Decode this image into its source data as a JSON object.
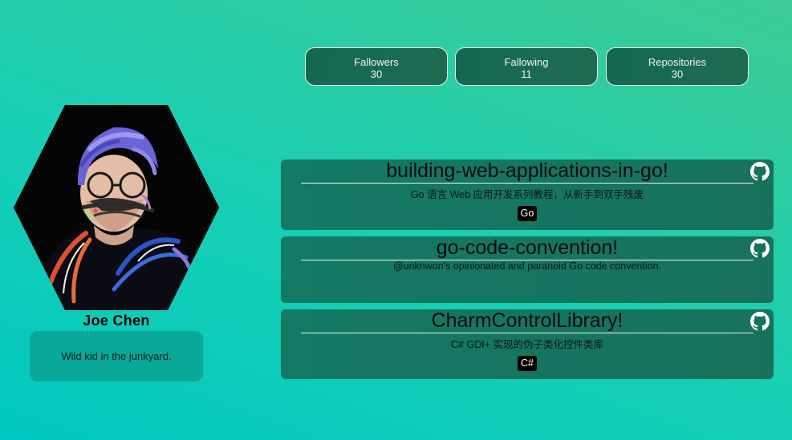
{
  "stats": {
    "followers": {
      "label": "Fallowers",
      "value": "30"
    },
    "following": {
      "label": "Fallowing",
      "value": "11"
    },
    "repositories": {
      "label": "Repositories",
      "value": "30"
    }
  },
  "profile": {
    "name": "Joe Chen",
    "bio": "Wild kid in the junkyard.",
    "avatar_icon": "portrait-avatar"
  },
  "repos": [
    {
      "title": "building-web-applications-in-go!",
      "description": "Go 语言 Web 应用开发系列教程，从新手到双手残废",
      "language": "Go",
      "icon": "github-icon"
    },
    {
      "title": "go-code-convention!",
      "description": "@unknwon's opinionated and paranoid Go code convention.",
      "language": "",
      "icon": "github-icon"
    },
    {
      "title": "CharmControlLibrary!",
      "description": "C# GDI+ 实现的伪子类化控件类库",
      "language": "C#",
      "icon": "github-icon"
    }
  ],
  "colors": {
    "card_bg": "#167560",
    "bio_bg": "#0aa899",
    "badge_bg": "#000000"
  }
}
